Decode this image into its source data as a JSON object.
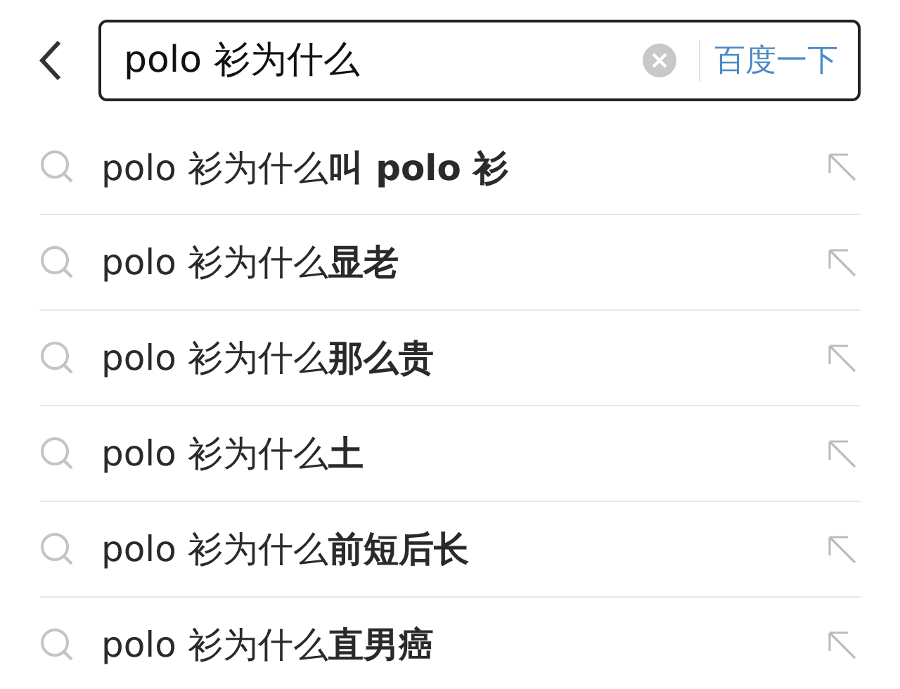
{
  "search": {
    "value": "polo 衫为什么",
    "button": "百度一下"
  },
  "suggestions": [
    {
      "text": "polo 衫为什么**叫 polo 衫**"
    },
    {
      "text": "polo 衫为什么**显老**"
    },
    {
      "text": "polo 衫为什么**那么贵**"
    },
    {
      "text": "polo 衫为什么**土**"
    },
    {
      "text": "polo 衫为什么**前短后长**"
    },
    {
      "text": "polo 衫为什么**直男癌**"
    }
  ]
}
